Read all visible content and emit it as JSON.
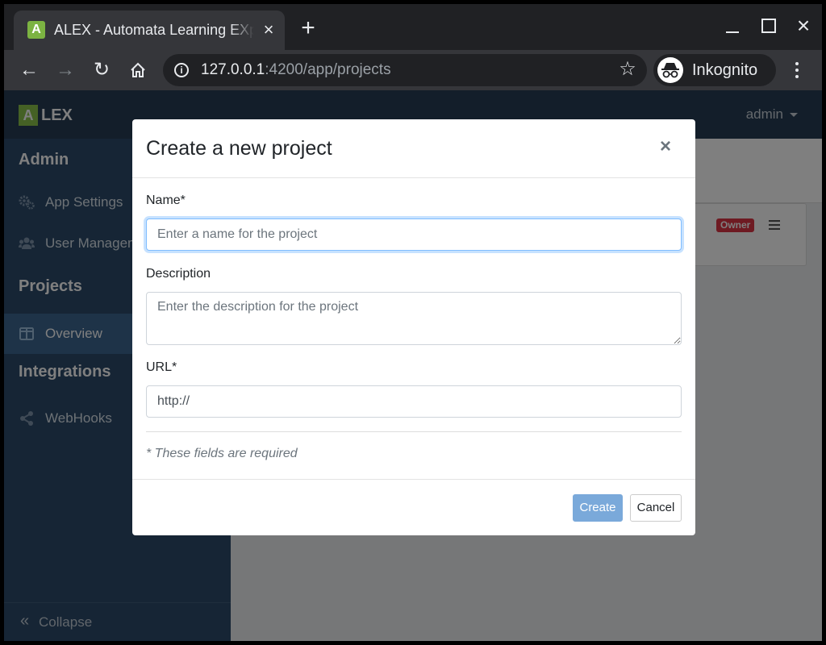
{
  "browser": {
    "tab_title": "ALEX - Automata Learning EXperience",
    "favicon_letter": "A",
    "url_host": "127.0.0.1",
    "url_path": ":4200/app/projects",
    "profile_name": "Inkognito"
  },
  "app": {
    "logo_letter": "A",
    "logo_text": "LEX",
    "user": "admin"
  },
  "sidebar": {
    "sections": [
      {
        "title": "Admin",
        "items": [
          {
            "label": "App Settings",
            "icon": "gears-icon"
          },
          {
            "label": "User Management",
            "icon": "users-icon"
          }
        ]
      },
      {
        "title": "Projects",
        "items": [
          {
            "label": "Overview",
            "icon": "columns-icon",
            "active": true
          }
        ]
      },
      {
        "title": "Integrations",
        "items": [
          {
            "label": "WebHooks",
            "icon": "share-icon"
          }
        ]
      }
    ],
    "collapse_label": "Collapse"
  },
  "content": {
    "project_badge": "Owner"
  },
  "modal": {
    "title": "Create a new project",
    "name_label": "Name*",
    "name_placeholder": "Enter a name for the project",
    "description_label": "Description",
    "description_placeholder": "Enter the description for the project",
    "url_label": "URL*",
    "url_value": "http://",
    "required_note": "* These fields are required",
    "create_label": "Create",
    "cancel_label": "Cancel"
  },
  "colors": {
    "appbar": "#263d54",
    "sidebar": "#2c4a6a",
    "sidebar_active": "#3c6690",
    "primary_button": "#7aa9da",
    "owner_badge": "#dc3545",
    "logo": "#8bc34a"
  }
}
